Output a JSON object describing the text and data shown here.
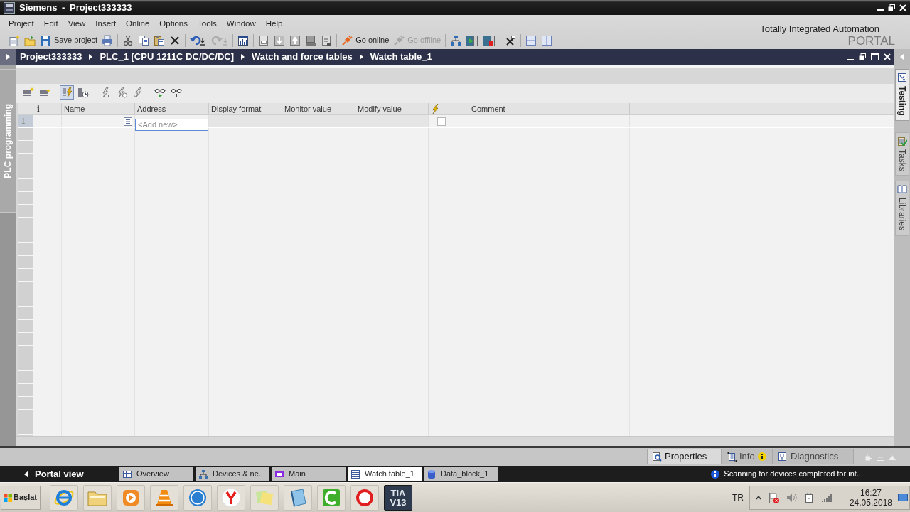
{
  "window": {
    "title": "Siemens - Project333333"
  },
  "menu": [
    "Project",
    "Edit",
    "View",
    "Insert",
    "Online",
    "Options",
    "Tools",
    "Window",
    "Help"
  ],
  "toolbar": [
    {
      "kind": "new",
      "disabled": false
    },
    {
      "kind": "open",
      "disabled": false
    },
    {
      "kind": "save",
      "label": "Save project",
      "disabled": false
    },
    {
      "kind": "print",
      "disabled": false
    },
    {
      "kind": "separator"
    },
    {
      "kind": "cut",
      "disabled": false
    },
    {
      "kind": "copy",
      "disabled": false
    },
    {
      "kind": "paste",
      "disabled": false
    },
    {
      "kind": "delete",
      "disabled": false
    },
    {
      "kind": "separator"
    },
    {
      "kind": "undo",
      "disabled": false
    },
    {
      "kind": "redo",
      "disabled": true
    },
    {
      "kind": "separator"
    },
    {
      "kind": "compile",
      "disabled": false
    },
    {
      "kind": "separator"
    },
    {
      "kind": "device",
      "disabled": false
    },
    {
      "kind": "download",
      "disabled": false
    },
    {
      "kind": "upload",
      "disabled": false
    },
    {
      "kind": "monitor",
      "disabled": false
    },
    {
      "kind": "runtime",
      "disabled": false
    },
    {
      "kind": "separator"
    },
    {
      "kind": "online",
      "label": "Go online",
      "disabled": false
    },
    {
      "kind": "offline",
      "label": "Go offline",
      "disabled": true
    },
    {
      "kind": "separator"
    },
    {
      "kind": "accessible",
      "disabled": false
    },
    {
      "kind": "simstart",
      "disabled": false
    },
    {
      "kind": "simstop",
      "disabled": false
    },
    {
      "kind": "separator"
    },
    {
      "kind": "crossref",
      "disabled": false
    },
    {
      "kind": "separator"
    },
    {
      "kind": "splith",
      "disabled": false
    },
    {
      "kind": "splitv",
      "disabled": false
    }
  ],
  "branding": {
    "line_1": "Totally Integrated Automation",
    "line_2": "PORTAL"
  },
  "breadcrumb": [
    "Project333333",
    "PLC_1 [CPU 1211C DC/DC/DC]",
    "Watch and force tables",
    "Watch table_1"
  ],
  "left_sidebar": {
    "tab": "PLC programming"
  },
  "right_sidebar": {
    "tabs": [
      {
        "kind": "testing",
        "label": "Testing",
        "selected": true
      },
      {
        "kind": "tasks",
        "label": "Tasks",
        "selected": false
      },
      {
        "kind": "libraries",
        "label": "Libraries",
        "selected": false
      }
    ]
  },
  "watch_table": {
    "toolbar": [
      {
        "kind": "insert",
        "pressed": false
      },
      {
        "kind": "add",
        "pressed": false
      },
      {
        "kind": "modifyall",
        "pressed": true
      },
      {
        "kind": "advanced",
        "pressed": false
      },
      {
        "kind": "modifynow",
        "pressed": false
      },
      {
        "kind": "modifytrigger",
        "pressed": false
      },
      {
        "kind": "peripheral",
        "pressed": false
      },
      {
        "kind": "monitorall",
        "pressed": false
      },
      {
        "kind": "monitoronce",
        "pressed": false
      }
    ],
    "columns": [
      {
        "kind": "info",
        "label": "i"
      },
      {
        "kind": "text",
        "label": "Name"
      },
      {
        "kind": "text",
        "label": "Address"
      },
      {
        "kind": "text",
        "label": "Display format"
      },
      {
        "kind": "text",
        "label": "Monitor value"
      },
      {
        "kind": "text",
        "label": "Modify value"
      },
      {
        "kind": "force"
      },
      {
        "kind": "text",
        "label": "Comment"
      }
    ],
    "rows": [
      {
        "number": "1",
        "address_placeholder": "<Add new>",
        "force_checked": false
      }
    ]
  },
  "inspector": {
    "tabs": [
      {
        "kind": "properties",
        "label": "Properties",
        "selected": true
      },
      {
        "kind": "info",
        "label": "Info",
        "selected": false
      },
      {
        "kind": "diagnostics",
        "label": "Diagnostics",
        "selected": false
      }
    ]
  },
  "editor_bar": {
    "portal_view": "Portal view",
    "tabs": [
      {
        "kind": "overview",
        "label": "Overview",
        "selected": false
      },
      {
        "kind": "devices",
        "label": "Devices & ne...",
        "selected": false
      },
      {
        "kind": "block",
        "label": "Main",
        "selected": false
      },
      {
        "kind": "watch",
        "label": "Watch table_1",
        "selected": true
      },
      {
        "kind": "datablock",
        "label": "Data_block_1",
        "selected": false
      }
    ],
    "status": "Scanning for devices completed for int..."
  },
  "taskbar": {
    "start": "Başlat",
    "apps": [
      {
        "kind": "ie",
        "selected": false
      },
      {
        "kind": "folder",
        "selected": false
      },
      {
        "kind": "media",
        "selected": false
      },
      {
        "kind": "vlc",
        "selected": false
      },
      {
        "kind": "bs",
        "selected": false
      },
      {
        "kind": "yandex",
        "selected": false
      },
      {
        "kind": "sticky",
        "selected": false
      },
      {
        "kind": "notebook",
        "selected": false
      },
      {
        "kind": "camtasia",
        "selected": false
      },
      {
        "kind": "studio",
        "selected": false
      },
      {
        "kind": "tia",
        "lines": [
          "TIA",
          "V13"
        ],
        "selected": true
      }
    ],
    "language": "TR",
    "time": "16:27",
    "date": "24.05.2018"
  }
}
